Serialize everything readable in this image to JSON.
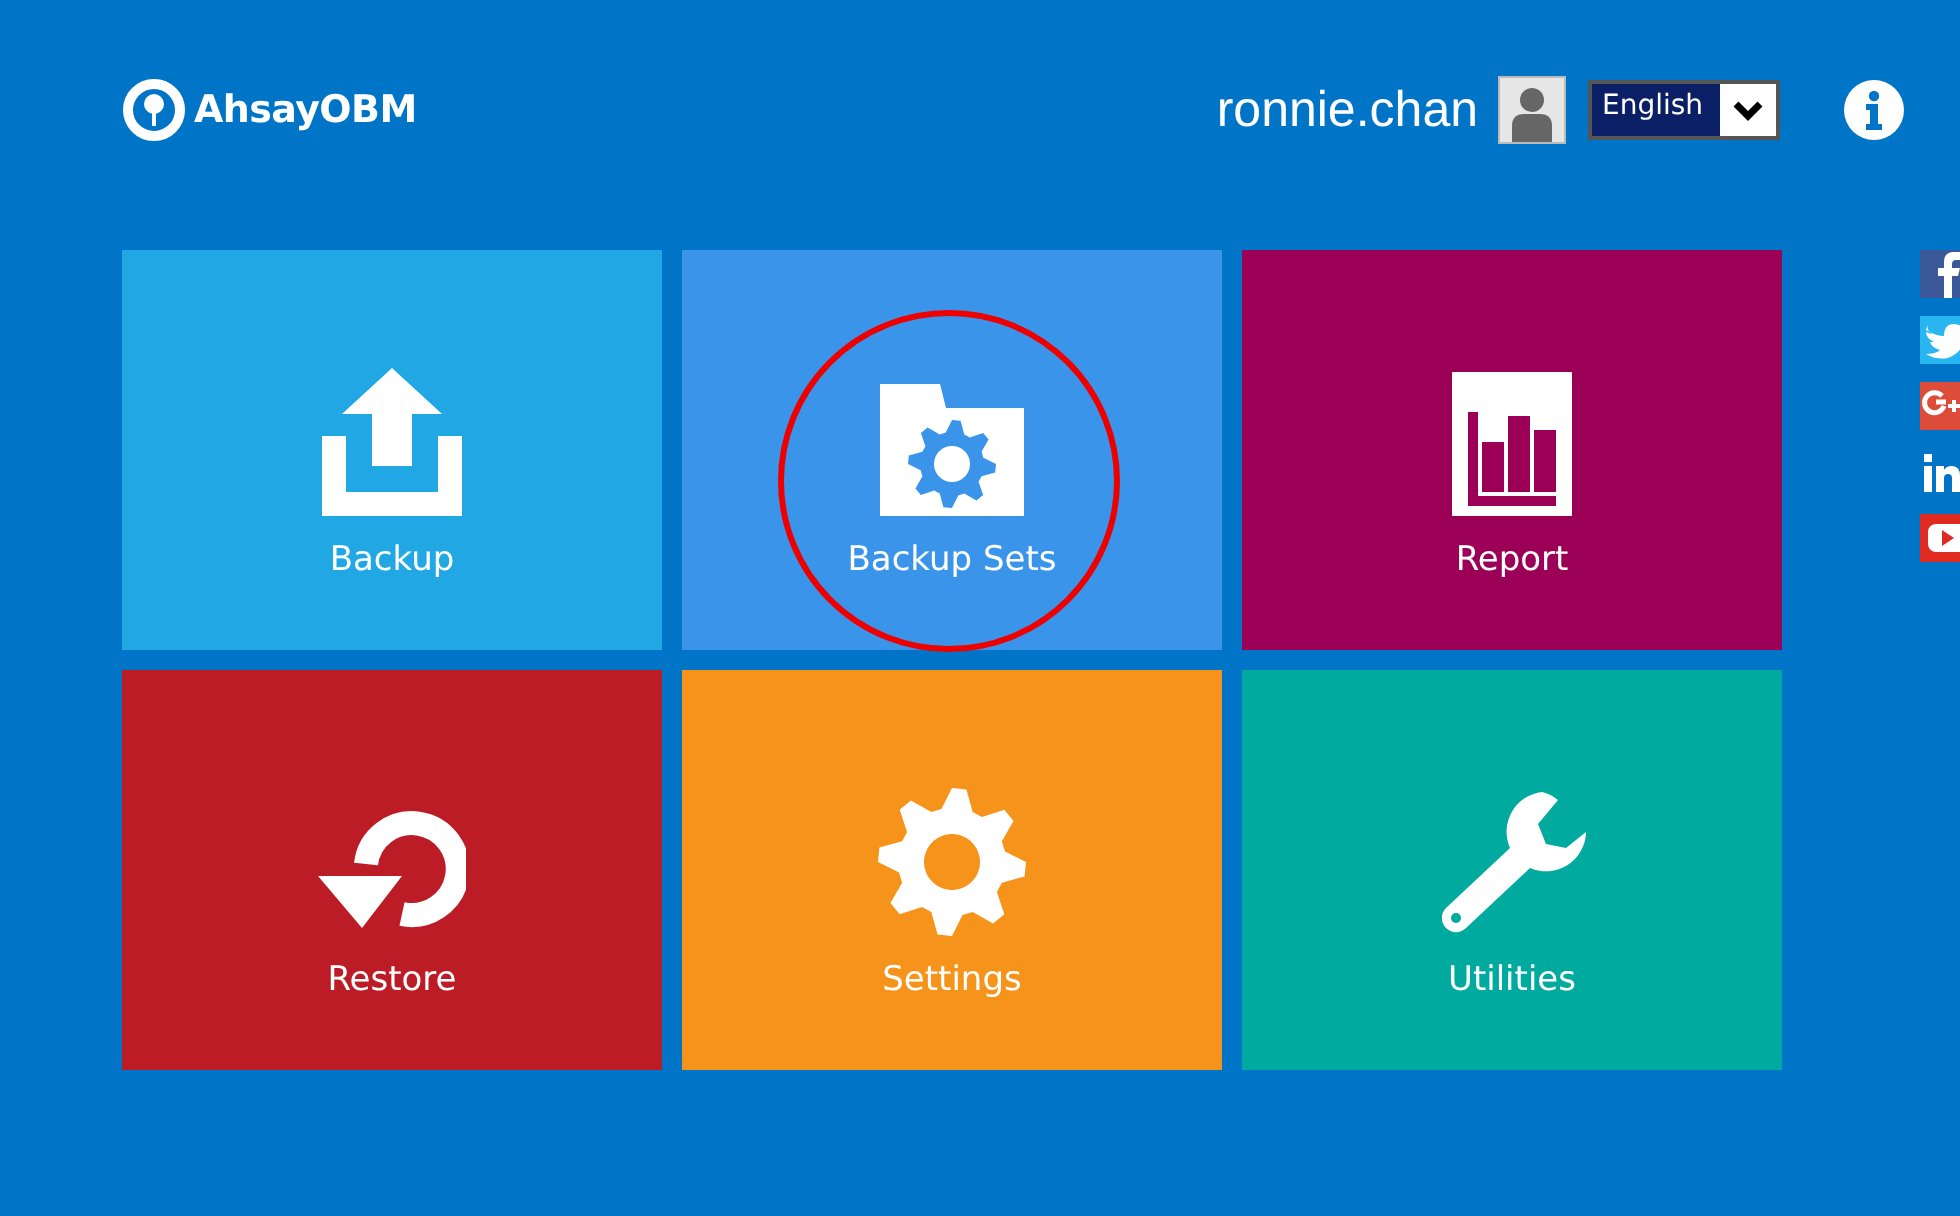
{
  "header": {
    "logo": "AhsayOBM",
    "username": "ronnie.chan",
    "language": "English"
  },
  "tiles": [
    {
      "label": "Backup",
      "kind": "upload",
      "color": "#22a7e5",
      "highlighted": false
    },
    {
      "label": "Backup Sets",
      "kind": "folder",
      "color": "#3a95ea",
      "highlighted": true
    },
    {
      "label": "Report",
      "kind": "report",
      "color": "#9c0056",
      "highlighted": false
    },
    {
      "label": "Restore",
      "kind": "restore",
      "color": "#bb1c25",
      "highlighted": false
    },
    {
      "label": "Settings",
      "kind": "gear",
      "color": "#f5931b",
      "highlighted": false
    },
    {
      "label": "Utilities",
      "kind": "wrench",
      "color": "#00aa9e",
      "highlighted": false
    }
  ],
  "social": [
    {
      "kind": "facebook"
    },
    {
      "kind": "twitter"
    },
    {
      "kind": "googleplus"
    },
    {
      "kind": "linkedin"
    },
    {
      "kind": "youtube"
    }
  ]
}
